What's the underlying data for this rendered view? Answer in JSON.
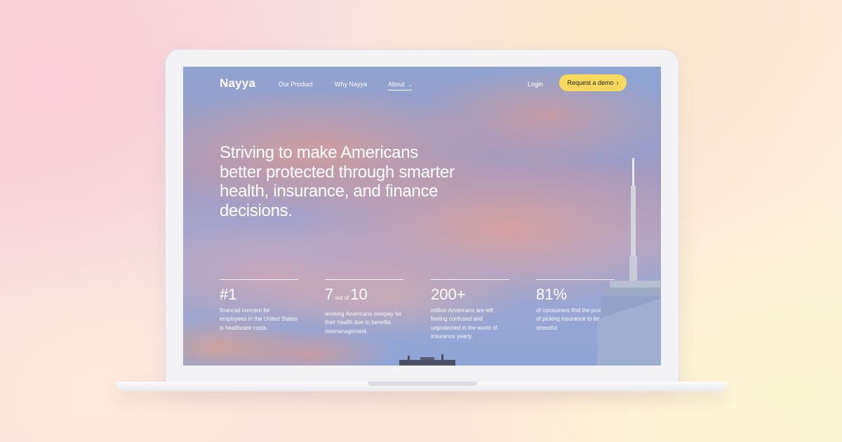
{
  "site": {
    "logo": "Nayya",
    "nav": {
      "items": [
        "Our Product",
        "Why Nayya",
        "About"
      ],
      "active": "About",
      "login": "Login",
      "cta": "Request a demo"
    },
    "hero": {
      "headline": "Striving to make Americans better protected through smarter health, insurance, and finance decisions."
    },
    "stats": [
      {
        "value": "#1",
        "description": "financial concern for employees in the United States is healthcare costs."
      },
      {
        "value_main": "7",
        "value_mid": "out of",
        "value_end": "10",
        "description": "working Americans overpay for their health due to benefits mismanagement."
      },
      {
        "value": "200+",
        "description": "million Americans are left feeling confused and unprotected in the world of insurance yearly."
      },
      {
        "value": "81%",
        "description": "of consumers find the process of picking insurance to be very stressful."
      }
    ]
  },
  "colors": {
    "cta_background": "#f8d95d",
    "text": "#ffffff",
    "cta_text": "#1e1e28"
  },
  "icons": {
    "about_dropdown": "chevron-down-icon",
    "cta_arrow": "chevron-right-icon"
  }
}
